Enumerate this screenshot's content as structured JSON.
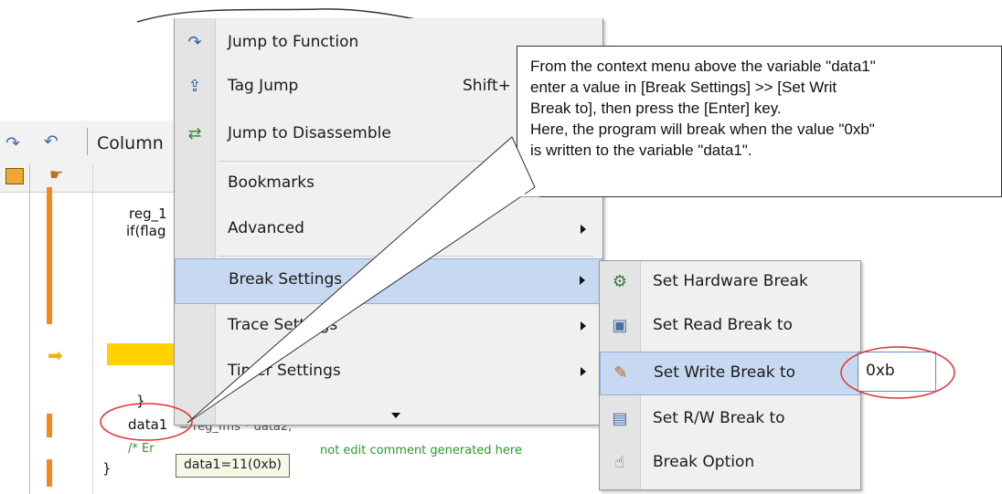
{
  "toolbar": {
    "column_label": "Column",
    "icons": [
      "refresh-icon",
      "undo-icon"
    ]
  },
  "code": {
    "line1": "reg_1",
    "line2": "if(flag",
    "line_brace": "}",
    "assign_start": "data1",
    "assign_rest": "= reg_fms * data2;",
    "comment_prefix": "/* Er",
    "comment_rest": "not edit comment generated here",
    "close_brace": "}"
  },
  "context_menu": {
    "items": [
      {
        "label": "Jump to Function",
        "icon": "jump-function-icon",
        "shortcut": "",
        "submenu": false
      },
      {
        "label": "Tag Jump",
        "icon": "tag-jump-icon",
        "shortcut": "Shift+",
        "submenu": false
      },
      {
        "label": "Jump to Disassemble",
        "icon": "disassemble-icon",
        "shortcut": "",
        "submenu": false
      },
      {
        "label": "Bookmarks",
        "icon": "",
        "shortcut": "",
        "submenu": false
      },
      {
        "label": "Advanced",
        "icon": "",
        "shortcut": "",
        "submenu": true
      },
      {
        "label": "Break Settings",
        "icon": "",
        "shortcut": "",
        "submenu": true,
        "highlighted": true
      },
      {
        "label": "Trace Settings",
        "icon": "",
        "shortcut": "",
        "submenu": true
      },
      {
        "label": "Timer Settings",
        "icon": "",
        "shortcut": "",
        "submenu": true
      }
    ]
  },
  "break_submenu": {
    "items": [
      {
        "label": "Set Hardware Break",
        "icon": "hardware-break-icon"
      },
      {
        "label": "Set Read Break to",
        "icon": "read-break-icon"
      },
      {
        "label": "Set Write Break to",
        "icon": "write-break-icon",
        "highlighted": true
      },
      {
        "label": "Set R/W Break to",
        "icon": "rw-break-icon"
      },
      {
        "label": "Break Option",
        "icon": "break-option-icon"
      }
    ],
    "write_value": "0xb"
  },
  "callout": {
    "lines": [
      "From the context menu above the variable \"data1\"",
      "enter a value in [Break Settings] >> [Set Writ",
      "Break to], then press the [Enter] key.",
      "Here, the program will break when the value \"0xb\"",
      "is written to the variable \"data1\"."
    ]
  },
  "tooltip": {
    "text": "data1=11(0xb)"
  },
  "colors": {
    "menu_bg": "#f0f0f0",
    "highlight": "#c7d9f1",
    "annotation_red": "#e53030",
    "current_line": "#ffd200",
    "gutter_bar": "#f28a1a",
    "comment_green": "#2a9a2a"
  }
}
